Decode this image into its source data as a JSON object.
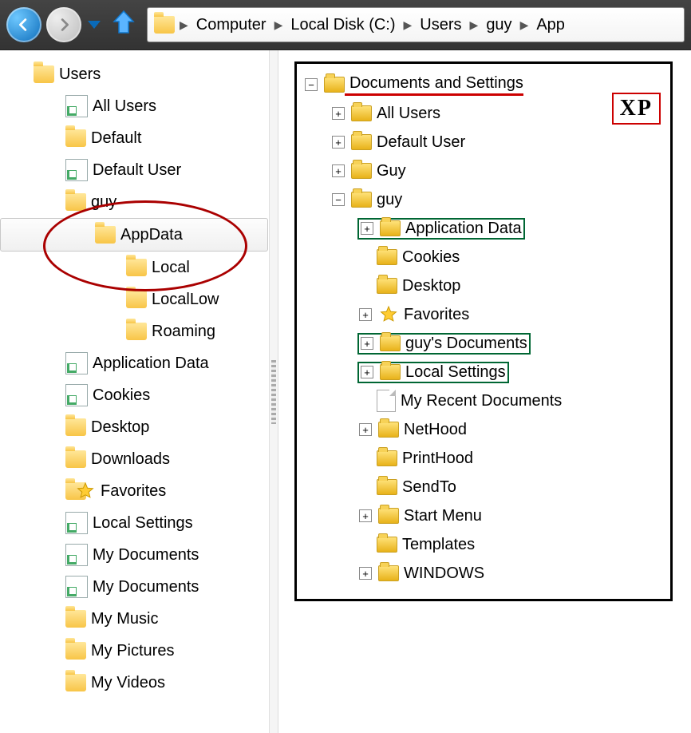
{
  "breadcrumb": [
    "Computer",
    "Local Disk (C:)",
    "Users",
    "guy",
    "App"
  ],
  "vista_tree": [
    {
      "indent": 42,
      "icon": "folder",
      "label": "Users"
    },
    {
      "indent": 82,
      "icon": "shortcut",
      "label": "All Users"
    },
    {
      "indent": 82,
      "icon": "folder",
      "label": "Default"
    },
    {
      "indent": 82,
      "icon": "shortcut",
      "label": "Default User"
    },
    {
      "indent": 82,
      "icon": "folder",
      "label": "guy"
    },
    {
      "indent": 118,
      "icon": "folder",
      "label": "AppData",
      "selected": true
    },
    {
      "indent": 158,
      "icon": "folder",
      "label": "Local"
    },
    {
      "indent": 158,
      "icon": "folder",
      "label": "LocalLow"
    },
    {
      "indent": 158,
      "icon": "folder",
      "label": "Roaming"
    },
    {
      "indent": 82,
      "icon": "shortcut",
      "label": "Application Data"
    },
    {
      "indent": 82,
      "icon": "shortcut",
      "label": "Cookies"
    },
    {
      "indent": 82,
      "icon": "folder",
      "label": "Desktop"
    },
    {
      "indent": 82,
      "icon": "folder",
      "label": "Downloads"
    },
    {
      "indent": 82,
      "icon": "folder-star",
      "label": "Favorites"
    },
    {
      "indent": 82,
      "icon": "shortcut",
      "label": "Local Settings"
    },
    {
      "indent": 82,
      "icon": "shortcut",
      "label": "My Documents"
    },
    {
      "indent": 82,
      "icon": "shortcut",
      "label": "My Documents"
    },
    {
      "indent": 82,
      "icon": "folder",
      "label": "My Music"
    },
    {
      "indent": 82,
      "icon": "folder",
      "label": "My Pictures"
    },
    {
      "indent": 82,
      "icon": "folder",
      "label": "My Videos"
    }
  ],
  "xp_badge": "XP",
  "xp_tree": [
    {
      "indent": 0,
      "pm": "minus",
      "icon": "open",
      "label": "Documents and Settings",
      "underline": true
    },
    {
      "indent": 34,
      "pm": "plus",
      "icon": "folder",
      "label": "All Users"
    },
    {
      "indent": 34,
      "pm": "plus",
      "icon": "folder",
      "label": "Default User"
    },
    {
      "indent": 34,
      "pm": "plus",
      "icon": "folder",
      "label": "Guy"
    },
    {
      "indent": 34,
      "pm": "minus",
      "icon": "open",
      "label": "guy"
    },
    {
      "indent": 68,
      "pm": "plus",
      "icon": "folder",
      "label": "Application Data",
      "box": true
    },
    {
      "indent": 68,
      "pm": "none",
      "icon": "folder",
      "label": "Cookies"
    },
    {
      "indent": 68,
      "pm": "none",
      "icon": "folder",
      "label": "Desktop"
    },
    {
      "indent": 68,
      "pm": "plus",
      "icon": "star",
      "label": "Favorites"
    },
    {
      "indent": 68,
      "pm": "plus",
      "icon": "folder",
      "label": "guy's Documents",
      "box": true
    },
    {
      "indent": 68,
      "pm": "plus",
      "icon": "folder",
      "label": "Local Settings",
      "box": true
    },
    {
      "indent": 68,
      "pm": "none",
      "icon": "doc",
      "label": "My Recent Documents"
    },
    {
      "indent": 68,
      "pm": "plus",
      "icon": "folder",
      "label": "NetHood"
    },
    {
      "indent": 68,
      "pm": "none",
      "icon": "folder",
      "label": "PrintHood"
    },
    {
      "indent": 68,
      "pm": "none",
      "icon": "folder",
      "label": "SendTo"
    },
    {
      "indent": 68,
      "pm": "plus",
      "icon": "folder",
      "label": "Start Menu"
    },
    {
      "indent": 68,
      "pm": "none",
      "icon": "folder",
      "label": "Templates"
    },
    {
      "indent": 68,
      "pm": "plus",
      "icon": "folder",
      "label": "WINDOWS"
    }
  ]
}
